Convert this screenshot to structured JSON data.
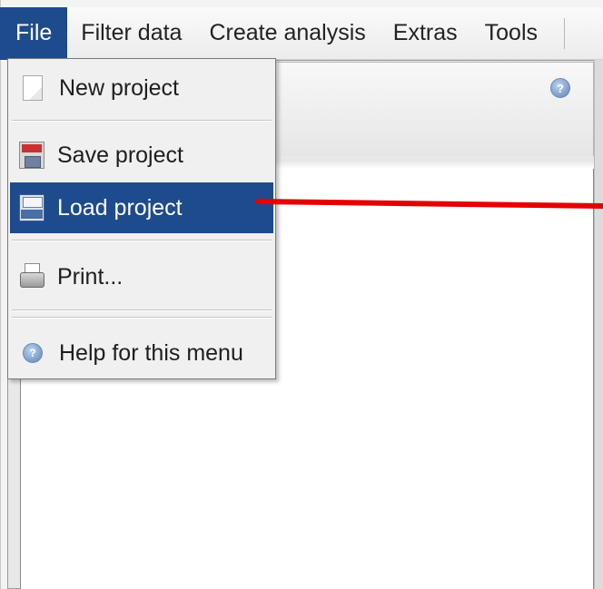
{
  "menubar": {
    "items": [
      {
        "label": "File"
      },
      {
        "label": "Filter data"
      },
      {
        "label": "Create analysis"
      },
      {
        "label": "Extras"
      },
      {
        "label": "Tools"
      }
    ]
  },
  "file_menu": {
    "items": [
      {
        "label": "New project",
        "icon": "new-document-icon"
      },
      {
        "label": "Save project",
        "icon": "save-icon"
      },
      {
        "label": "Load project",
        "icon": "load-icon",
        "selected": true
      },
      {
        "label": "Print...",
        "icon": "printer-icon"
      },
      {
        "label": "Help for this menu",
        "icon": "help-icon"
      }
    ]
  },
  "colors": {
    "menu_highlight": "#1e4b8c",
    "annotation_arrow": "#e50000"
  }
}
